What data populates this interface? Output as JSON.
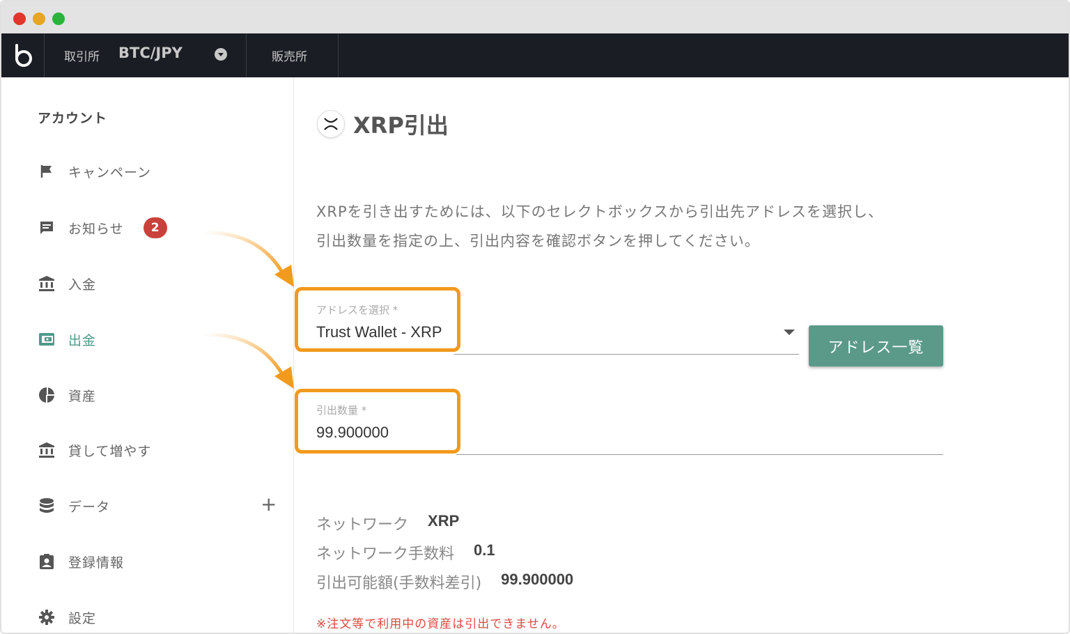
{
  "window": {
    "traffic_lights": [
      "close",
      "minimize",
      "zoom"
    ]
  },
  "topnav": {
    "logo_icon": "bitbank-logo-icon",
    "exchange_label": "取引所",
    "pair": "BTC/JPY",
    "shop_label": "販売所"
  },
  "sidebar": {
    "title": "アカウント",
    "items": [
      {
        "label": "キャンペーン",
        "icon": "flag-icon"
      },
      {
        "label": "お知らせ",
        "icon": "message-icon",
        "badge": "2"
      },
      {
        "label": "入金",
        "icon": "bank-icon"
      },
      {
        "label": "出金",
        "icon": "wallet-icon",
        "active": true
      },
      {
        "label": "資産",
        "icon": "pie-chart-icon"
      },
      {
        "label": "貸して増やす",
        "icon": "bank-icon"
      },
      {
        "label": "データ",
        "icon": "database-icon",
        "expand": "+"
      },
      {
        "label": "登録情報",
        "icon": "id-badge-icon"
      },
      {
        "label": "設定",
        "icon": "gear-icon"
      }
    ]
  },
  "main": {
    "title": "XRP引出",
    "description_line1": "XRPを引き出すためには、以下のセレクトボックスから引出先アドレスを選択し、",
    "description_line2": "引出数量を指定の上、引出内容を確認ボタンを押してください。",
    "address_field": {
      "label": "アドレスを選択 *",
      "value": "Trust Wallet - XRP"
    },
    "address_list_button": "アドレス一覧",
    "amount_field": {
      "label": "引出数量 *",
      "value": "99.900000"
    },
    "info": [
      {
        "label": "ネットワーク",
        "value": "XRP"
      },
      {
        "label": "ネットワーク手数料",
        "value": "0.1"
      },
      {
        "label": "引出可能額(手数料差引)",
        "value": "99.900000"
      }
    ],
    "warning": "※注文等で利用中の資産は引出できません。"
  },
  "colors": {
    "accent": "#5b9a89",
    "highlight": "#f29a1d",
    "badge": "#c9413a",
    "nav_bg": "#1b1d24",
    "warning": "#d94a3f"
  }
}
